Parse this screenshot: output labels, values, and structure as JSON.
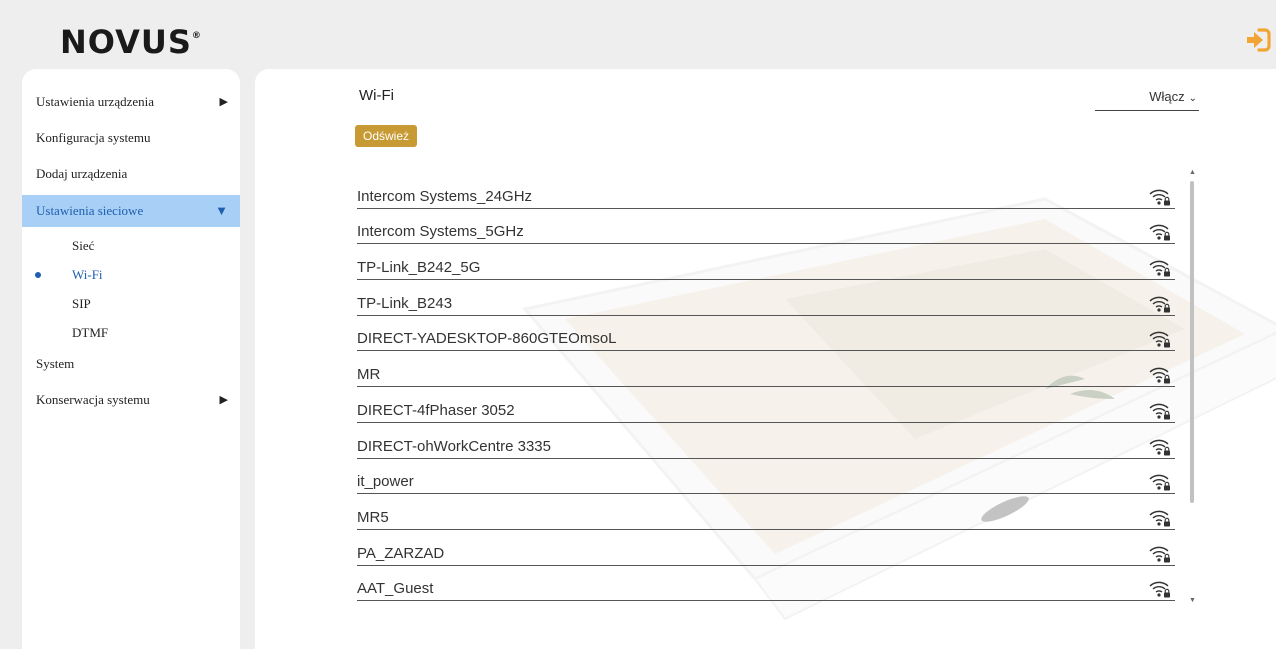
{
  "header": {
    "logo_text": "NOVUS",
    "logo_mark": "®",
    "logout_icon": "logout-arrow-icon",
    "accent_color": "#f2a534"
  },
  "sidebar": {
    "items": [
      {
        "label": "Ustawienia urządzenia",
        "arrow": "▶"
      },
      {
        "label": "Konfiguracja systemu"
      },
      {
        "label": "Dodaj urządzenia"
      },
      {
        "label": "Ustawienia sieciowe",
        "arrow": "▼",
        "active": true
      },
      {
        "label": "System"
      },
      {
        "label": "Konserwacja systemu",
        "arrow": "▶"
      }
    ],
    "sub_items": [
      {
        "label": "Sieć"
      },
      {
        "label": "Wi-Fi",
        "active": true
      },
      {
        "label": "SIP"
      },
      {
        "label": "DTMF"
      }
    ],
    "active_bg": "#a8cff5",
    "active_color": "#1e5fb0"
  },
  "main": {
    "title": "Wi-Fi",
    "select_value": "Włącz",
    "refresh_label": "Odśwież",
    "refresh_color": "#c79a34",
    "networks": [
      "Intercom Systems_24GHz",
      "Intercom Systems_5GHz",
      "TP-Link_B242_5G",
      "TP-Link_B243",
      "DIRECT-YADESKTOP-860GTEOmsoL",
      "MR",
      "DIRECT-4fPhaser 3052",
      "DIRECT-ohWorkCentre 3335",
      "it_power",
      "MR5",
      "PA_ZARZAD",
      "AAT_Guest"
    ],
    "network_icon": "wifi-lock-icon"
  }
}
